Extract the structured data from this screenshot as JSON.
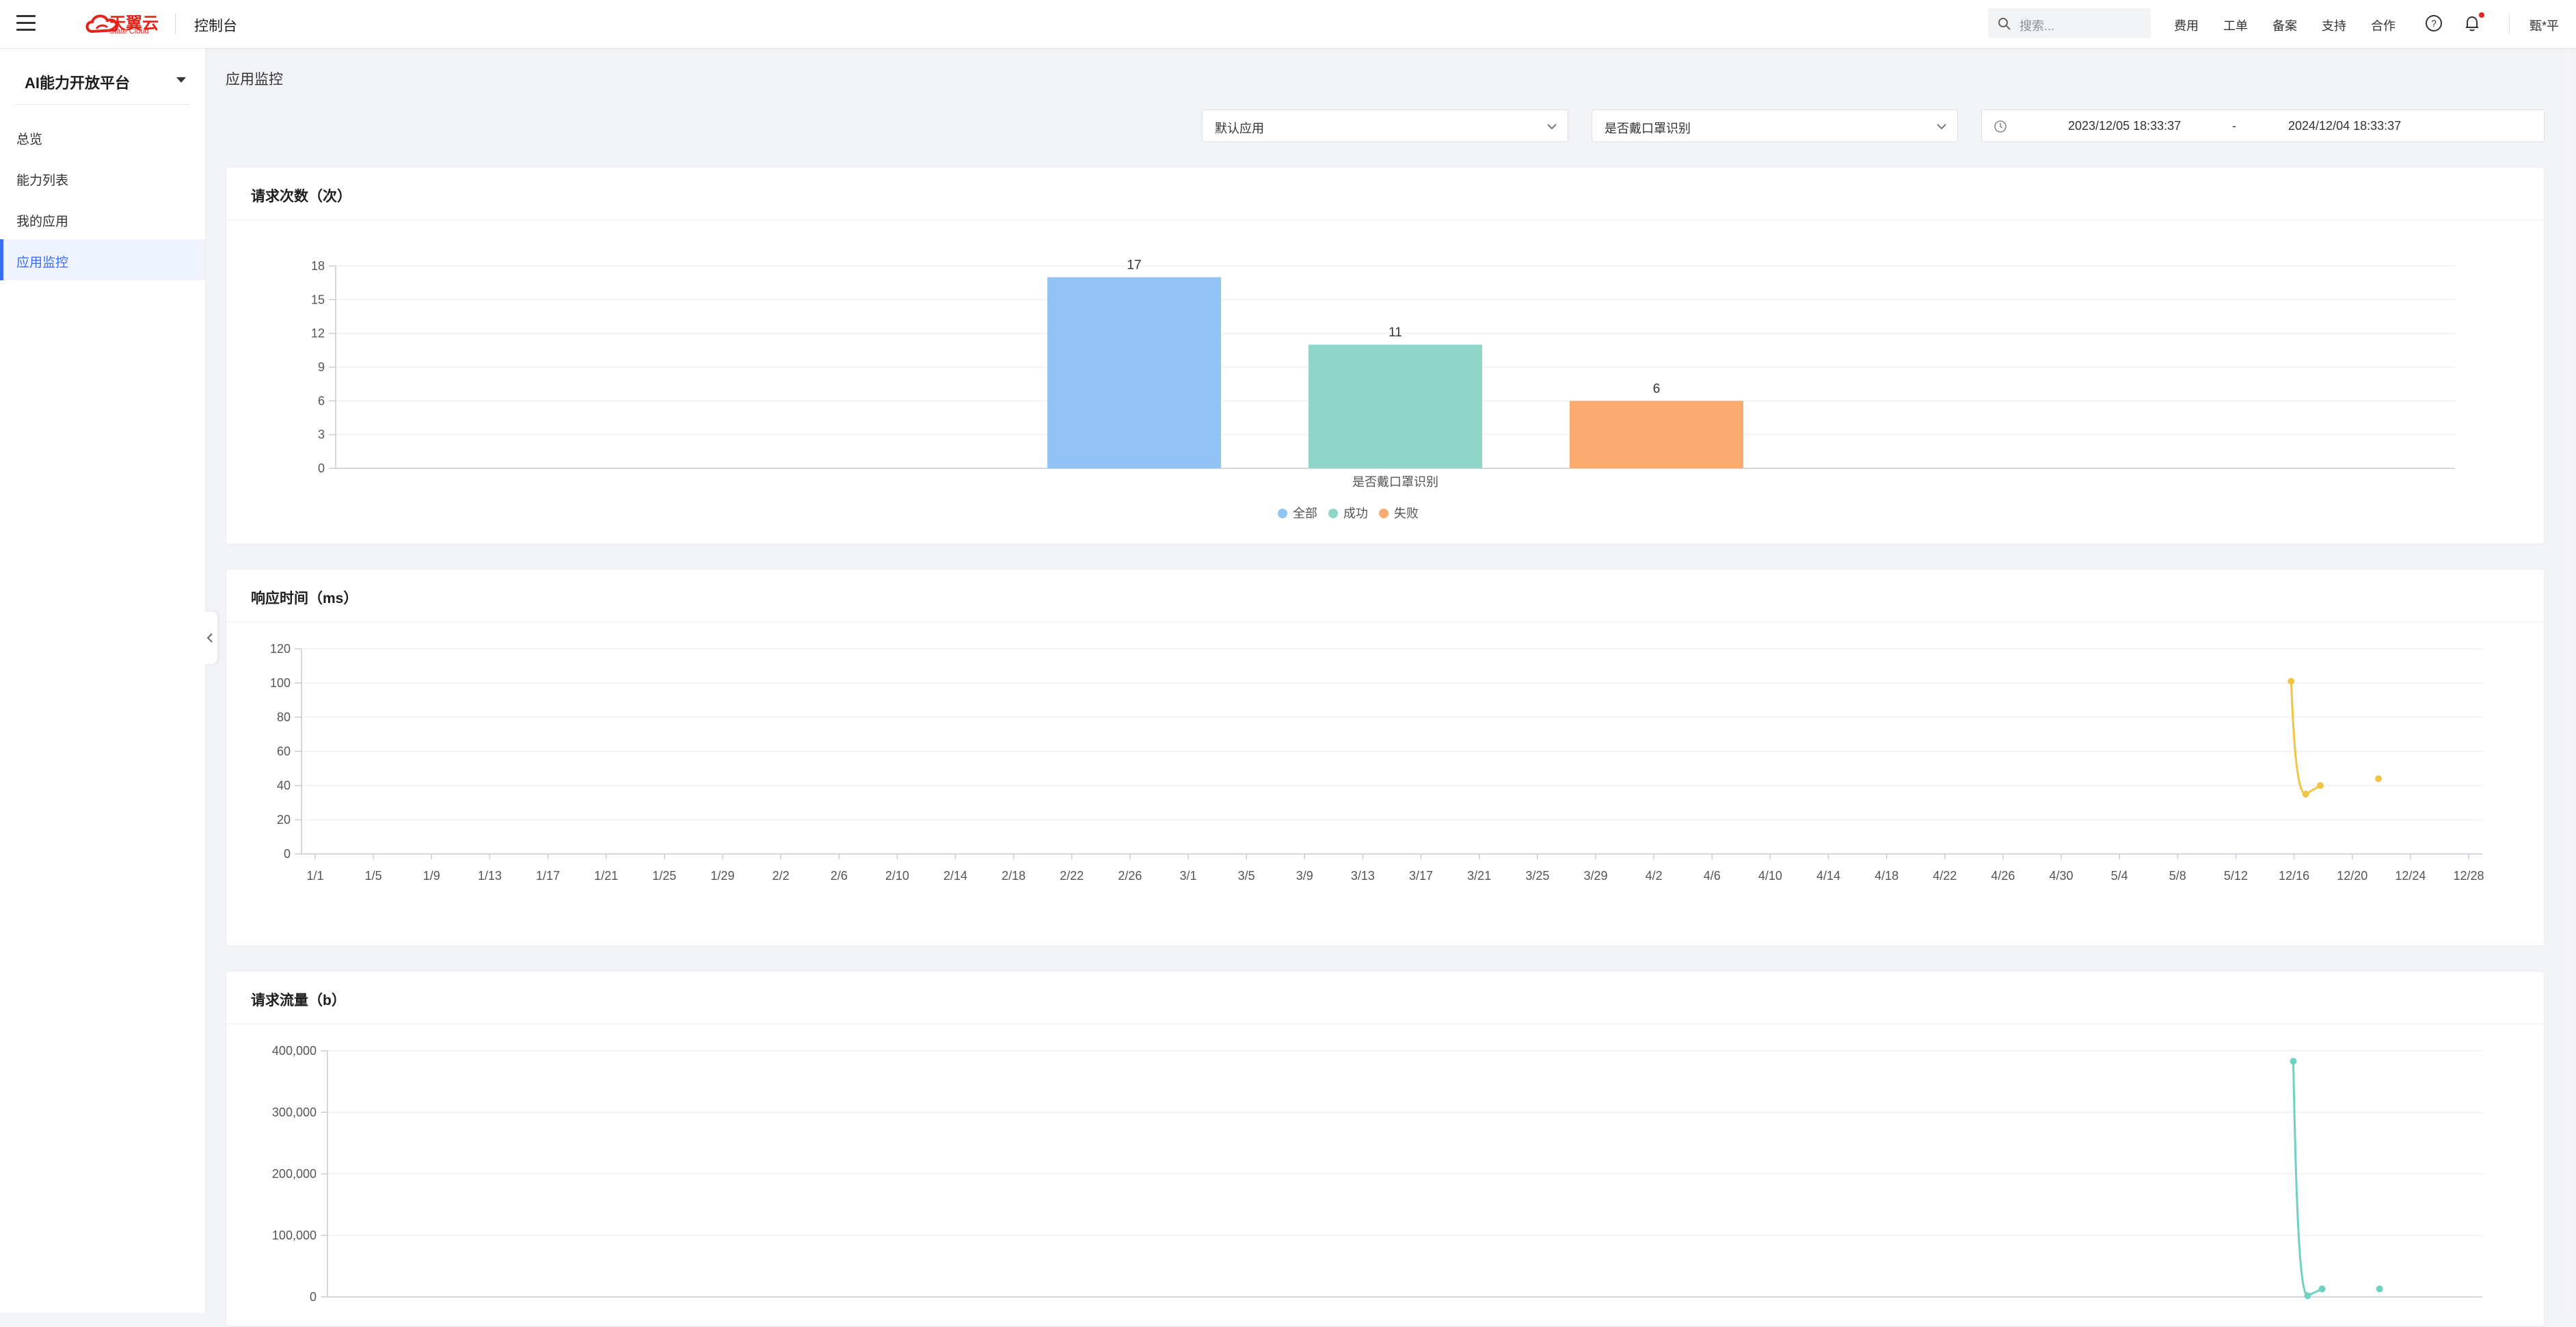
{
  "topbar": {
    "logo_text": "天翼云",
    "logo_sub": "State Cloud",
    "console_title": "控制台",
    "search_placeholder": "搜索...",
    "nav": [
      "费用",
      "工单",
      "备案",
      "支持",
      "合作"
    ],
    "user": "甄*平",
    "colors": {
      "brand": "#e1251b",
      "notification": "#e1251b"
    }
  },
  "sidebar": {
    "platform": "AI能力开放平台",
    "items": [
      {
        "label": "总览",
        "active": false
      },
      {
        "label": "能力列表",
        "active": false
      },
      {
        "label": "我的应用",
        "active": false
      },
      {
        "label": "应用监控",
        "active": true
      }
    ],
    "active_color": "#3c6df0"
  },
  "main": {
    "title": "应用监控",
    "filters": {
      "app": "默认应用",
      "capability": "是否戴口罩识别",
      "date_start": "2023/12/05 18:33:37",
      "date_sep": "-",
      "date_end": "2024/12/04 18:33:37"
    },
    "cards": [
      {
        "title": "请求次数（次）"
      },
      {
        "title": "响应时间（ms）"
      },
      {
        "title": "请求流量（b）"
      }
    ]
  },
  "chart_data": [
    {
      "type": "bar",
      "title": "请求次数（次）",
      "categories": [
        "是否戴口罩识别"
      ],
      "series": [
        {
          "name": "全部",
          "values": [
            17
          ],
          "color": "#91c4f5"
        },
        {
          "name": "成功",
          "values": [
            11
          ],
          "color": "#8fd5c8"
        },
        {
          "name": "失败",
          "values": [
            6
          ],
          "color": "#fbab70"
        }
      ],
      "ylim": [
        0,
        18
      ],
      "yticks": [
        0,
        3,
        6,
        9,
        12,
        15,
        18
      ],
      "legend": "bottom-center",
      "grid": true
    },
    {
      "type": "line",
      "title": "响应时间（ms）",
      "x": [
        "1/1",
        "1/5",
        "1/9",
        "1/13",
        "1/17",
        "1/21",
        "1/25",
        "1/29",
        "2/2",
        "2/6",
        "2/10",
        "2/14",
        "2/18",
        "2/22",
        "2/26",
        "3/1",
        "3/5",
        "3/9",
        "3/13",
        "3/17",
        "3/21",
        "3/25",
        "3/29",
        "4/2",
        "4/6",
        "4/10",
        "4/14",
        "4/18",
        "4/22",
        "4/26",
        "4/30",
        "5/4",
        "5/8",
        "5/12",
        "12/16",
        "12/20",
        "12/24",
        "12/28"
      ],
      "series": [
        {
          "color": "#f0c445",
          "points": [
            {
              "x": 33.95,
              "y": 101
            },
            {
              "x": 34.2,
              "y": 35
            },
            {
              "x": 34.45,
              "y": 40
            },
            {
              "x": 35.45,
              "y": 44
            }
          ]
        }
      ],
      "ylim": [
        0,
        120
      ],
      "yticks": [
        0,
        20,
        40,
        60,
        80,
        100,
        120
      ],
      "grid": true
    },
    {
      "type": "line",
      "title": "请求流量（b）",
      "series": [
        {
          "color": "#6fd1c1",
          "points": [
            {
              "x": 33.95,
              "y": 383000
            },
            {
              "x": 34.2,
              "y": 2000
            },
            {
              "x": 34.45,
              "y": 13000
            },
            {
              "x": 35.45,
              "y": 13000
            }
          ]
        }
      ],
      "ylim": [
        0,
        400000
      ],
      "yticks": [
        "0",
        "100,000",
        "200,000",
        "300,000",
        "400,000"
      ],
      "grid": true
    }
  ]
}
